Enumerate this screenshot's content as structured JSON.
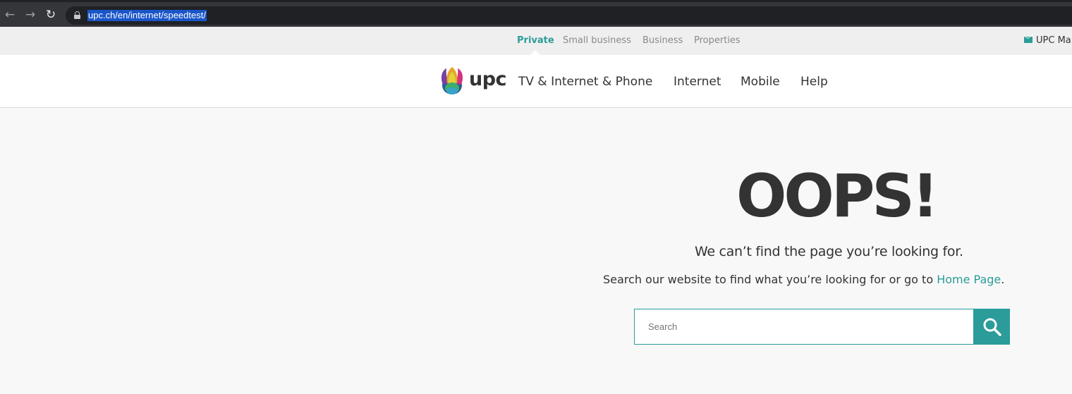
{
  "browser": {
    "url": "upc.ch/en/internet/speedtest/"
  },
  "segments": [
    {
      "label": "Private",
      "active": true
    },
    {
      "label": "Small business",
      "active": false
    },
    {
      "label": "Business",
      "active": false
    },
    {
      "label": "Properties",
      "active": false
    }
  ],
  "mail_link": "UPC Ma",
  "brand": {
    "logo_text": "upc",
    "accent": "#2b9c99"
  },
  "menu": [
    "TV & Internet & Phone",
    "Internet",
    "Mobile",
    "Help"
  ],
  "error": {
    "title": "OOPS!",
    "message": "We can’t find the page you’re looking for.",
    "hint_before": "Search our website to find what you’re looking for or go to ",
    "home_link": "Home Page",
    "hint_after": "."
  },
  "search": {
    "placeholder": "Search",
    "value": ""
  }
}
